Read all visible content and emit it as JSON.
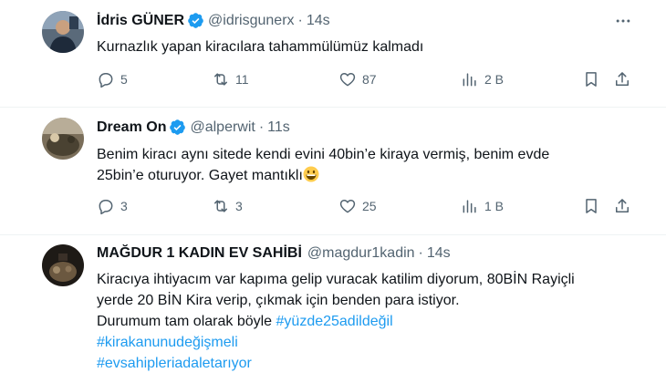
{
  "tweets": [
    {
      "name": "İdris GÜNER",
      "handle": "@idrisgunerx",
      "dot": "·",
      "time": "14s",
      "text_lines": [
        "Kurnazlık yapan kiracılara tahammülümüz kalmadı"
      ],
      "replies": "5",
      "retweets": "11",
      "likes": "87",
      "views": "2 B"
    },
    {
      "name": "Dream On",
      "handle": "@alperwit",
      "dot": "·",
      "time": "11s",
      "text_lines": [
        "Benim kiracı aynı sitede kendi evini 40bin’e kiraya vermiş, benim evde",
        "25bin’e oturuyor. Gayet mantıklı"
      ],
      "replies": "3",
      "retweets": "3",
      "likes": "25",
      "views": "1 B"
    },
    {
      "name": "MAĞDUR 1 KADIN EV SAHİBİ",
      "handle": "@magdur1kadin",
      "dot": "·",
      "time": "14s",
      "text_lines": [
        "Kiracıya ihtiyacım var kapıma gelip vuracak katilim diyorum, 80BİN Rayiçli",
        "yerde 20 BİN Kira verip, çıkmak için benden para istiyor.",
        "Durumum tam olarak böyle "
      ],
      "hashtags": [
        "#yüzde25adildeğil",
        "#kirakanunudeğişmeli",
        "#evsahipleriadaletarıyor"
      ]
    }
  ],
  "icons": {
    "reply": "reply-icon",
    "retweet": "retweet-icon",
    "like": "heart-icon",
    "views": "views-icon",
    "bookmark": "bookmark-icon",
    "share": "share-icon",
    "more": "more-icon",
    "verified": "verified-badge-icon",
    "emoji": "grinning-face-emoji"
  },
  "colors": {
    "text": "#0f1419",
    "secondary": "#536471",
    "accent": "#1d9bf0",
    "divider": "#eff3f4"
  }
}
